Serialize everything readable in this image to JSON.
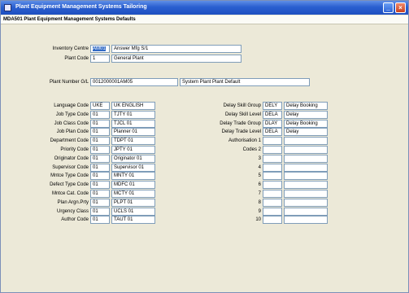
{
  "window": {
    "title": "Plant Equipment Management Systems Tailoring",
    "subtitle": "MDA501 Plant Equipment Management Systems Defaults"
  },
  "header_fields": {
    "inventory_centre": {
      "label": "Inventory Centre",
      "code": "AM01",
      "desc": "Answer Mfg S/1"
    },
    "plant_code": {
      "label": "Plant Code",
      "code": "1",
      "desc": "General Plant"
    },
    "plant_number_gl": {
      "label": "Plant Number G/L",
      "code": "0012000001AM05",
      "desc": "System Plant Plant Default"
    }
  },
  "left_fields": [
    {
      "label": "Language Code",
      "code": "UKE",
      "desc": "UK ENGLISH"
    },
    {
      "label": "Job Type Code",
      "code": "01",
      "desc": "TJTY 01"
    },
    {
      "label": "Job Class Code",
      "code": "01",
      "desc": "TJCL 01"
    },
    {
      "label": "Job Plan Code",
      "code": "01",
      "desc": "Planner 01"
    },
    {
      "label": "Department Code",
      "code": "01",
      "desc": "TDPT 01"
    },
    {
      "label": "Priority Code",
      "code": "01",
      "desc": "JPTY 01"
    },
    {
      "label": "Originator Code",
      "code": "01",
      "desc": "Originator 01"
    },
    {
      "label": "Supervisor Code",
      "code": "01",
      "desc": "Supervisor 01"
    },
    {
      "label": "Mntce Type Code",
      "code": "01",
      "desc": "MNTY 01"
    },
    {
      "label": "Defect Type Code",
      "code": "01",
      "desc": "MDFC 01"
    },
    {
      "label": "Mntce Cat. Code",
      "code": "01",
      "desc": "MCTY 01"
    },
    {
      "label": "Plan Argn.Prty",
      "code": "01",
      "desc": "PLPT 01"
    },
    {
      "label": "Urgency Class",
      "code": "01",
      "desc": "UCLS 01"
    },
    {
      "label": "Author Code",
      "code": "01",
      "desc": "TAUT 01"
    }
  ],
  "right_fields": [
    {
      "label": "Delay Skill Group",
      "code": "DELY",
      "desc": "Delay Booking"
    },
    {
      "label": "Delay Skill Level",
      "code": "DELA",
      "desc": "Delay"
    },
    {
      "label": "Delay Trade Group",
      "code": "DLAY",
      "desc": "Delay Booking"
    },
    {
      "label": "Delay Trade Level",
      "code": "DELA",
      "desc": "Delay"
    },
    {
      "label": "Authorisation 1",
      "code": "",
      "desc": ""
    },
    {
      "label": "Codes 2",
      "code": "",
      "desc": ""
    },
    {
      "label": "3",
      "code": "",
      "desc": ""
    },
    {
      "label": "4",
      "code": "",
      "desc": ""
    },
    {
      "label": "5",
      "code": "",
      "desc": ""
    },
    {
      "label": "6",
      "code": "",
      "desc": ""
    },
    {
      "label": "7",
      "code": "",
      "desc": ""
    },
    {
      "label": "8",
      "code": "",
      "desc": ""
    },
    {
      "label": "9",
      "code": "",
      "desc": ""
    },
    {
      "label": "10",
      "code": "",
      "desc": ""
    }
  ]
}
